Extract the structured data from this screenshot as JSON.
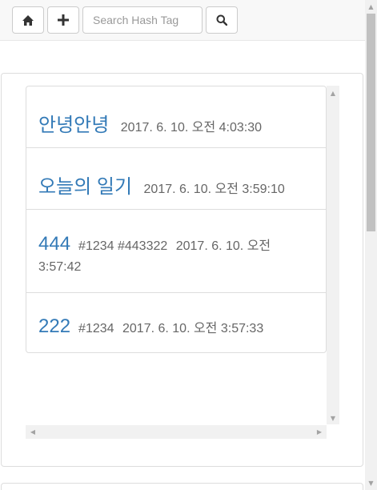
{
  "toolbar": {
    "search_placeholder": "Search Hash Tag",
    "icons": {
      "home": "home-icon",
      "add": "plus-icon",
      "search": "search-icon"
    }
  },
  "posts": [
    {
      "title": "안녕안녕",
      "tags": "",
      "date": "2017. 6. 10. 오전 4:03:30"
    },
    {
      "title": "오늘의 일기",
      "tags": "",
      "date": "2017. 6. 10. 오전 3:59:10"
    },
    {
      "title": "444",
      "tags": "#1234 #443322",
      "date": "2017. 6. 10. 오전 3:57:42"
    },
    {
      "title": "222",
      "tags": "#1234",
      "date": "2017. 6. 10. 오전 3:57:33"
    }
  ],
  "colors": {
    "title_link": "#337ab7",
    "border": "#dddddd",
    "toolbar_bg": "#f8f8f8"
  }
}
